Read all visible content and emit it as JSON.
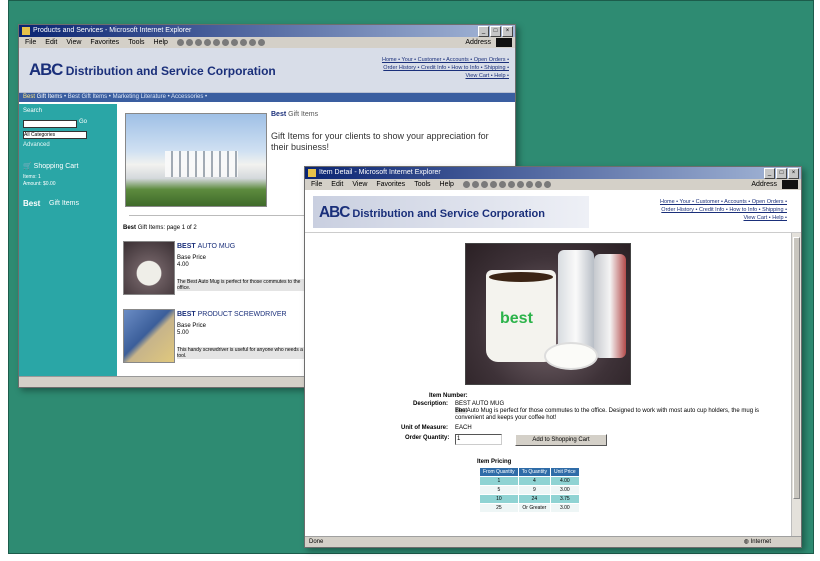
{
  "back_window": {
    "title": "Products and Services - Microsoft Internet Explorer",
    "menu": [
      "File",
      "Edit",
      "View",
      "Favorites",
      "Tools",
      "Help"
    ],
    "address_label": "Address",
    "logo_abc": "ABC",
    "logo_rest": "Distribution and Service Corporation",
    "nav_lines": [
      "Home • Your • Customer • Accounts • Open Orders •",
      "Order History • Credit Info • How to Info • Shipping •",
      "View Cart • Help •"
    ],
    "bluebar_best": "Best",
    "bluebar_rest": " Gift Items",
    "bluebar_more": "• Best Gift Items • Marketing Literature • Accessories •",
    "sidebar": {
      "search_label": "Search",
      "go_label": "Go",
      "select_value": "All Categories",
      "advanced": "Advanced",
      "cart_title": "Shopping Cart",
      "cart_items": "Items: 1",
      "cart_amount": "Amount: $0.00",
      "best_label": "Best",
      "gift_label": "Gift Items"
    },
    "section_title_best": "Best",
    "section_title_rest": "Gift Items",
    "tagline": "Gift Items for your clients to show your appreciation for their business!",
    "page_info_best": "Best",
    "page_info_rest": "Gift Items: page 1 of 2",
    "products": [
      {
        "name_best": "BEST",
        "name_rest": "AUTO MUG",
        "price_label": "Base Price",
        "price": "4.00",
        "desc": "The Best Auto Mug is perfect for those commutes to the office."
      },
      {
        "name_best": "BEST",
        "name_rest": "PRODUCT SCREWDRIVER",
        "price_label": "Base Price",
        "price": "5.00",
        "desc": "This handy screwdriver is useful for anyone who needs a tool."
      }
    ]
  },
  "front_window": {
    "title": "Item Detail - Microsoft Internet Explorer",
    "menu": [
      "File",
      "Edit",
      "View",
      "Favorites",
      "Tools",
      "Help"
    ],
    "address_label": "Address",
    "logo_abc": "ABC",
    "logo_rest": "Distribution and Service Corporation",
    "nav_lines": [
      "Home • Your • Customer • Accounts • Open Orders •",
      "Order History • Credit Info • How to Info • Shipping •",
      "View Cart • Help •"
    ],
    "mug_brand": "best",
    "item": {
      "number_label": "Item Number:",
      "description_label": "Description:",
      "description_best": "BEST",
      "description_name": "AUTO MUG",
      "description_text_best": "Best",
      "description_text": "The  Auto Mug is perfect for those commutes to the office. Designed to work with most auto cup holders, the mug is convenient and keeps your coffee hot!",
      "uom_label": "Unit of Measure:",
      "uom_value": "EACH",
      "qty_label": "Order Quantity:",
      "qty_value": "1",
      "add_button": "Add to Shopping Cart"
    },
    "pricing": {
      "title": "Item Pricing",
      "headers": [
        "From Quantity",
        "To Quantity",
        "Unit Price"
      ],
      "rows": [
        [
          "1",
          "4",
          "4.00"
        ],
        [
          "5",
          "9",
          "3.00"
        ],
        [
          "10",
          "24",
          "3.75"
        ],
        [
          "25",
          "Or Greater",
          "3.00"
        ]
      ]
    },
    "status_left": "Done",
    "status_right": "Internet"
  }
}
